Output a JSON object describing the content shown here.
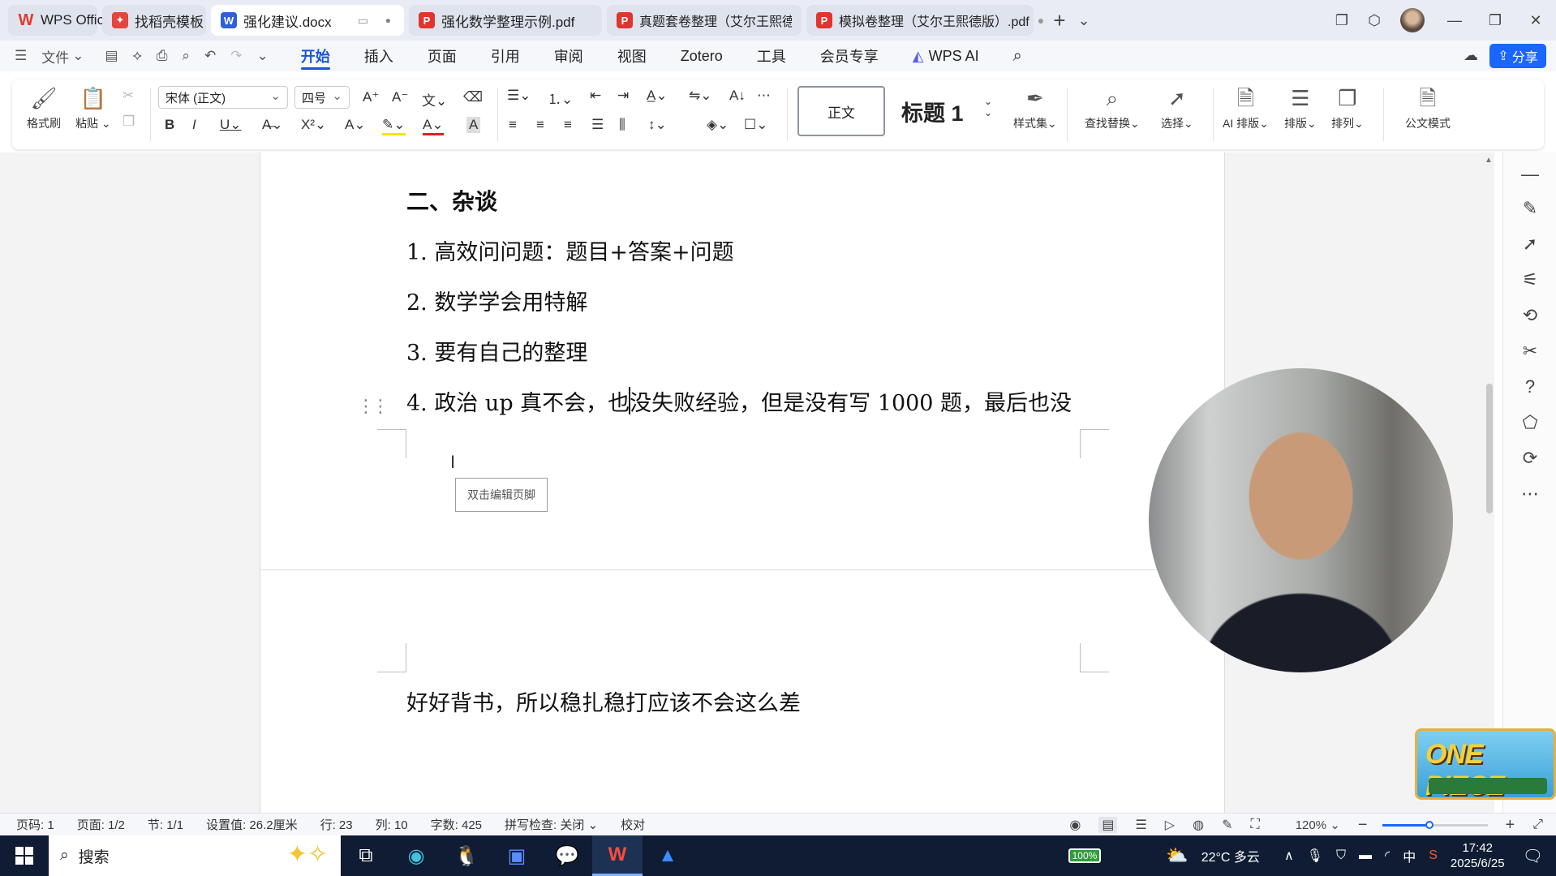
{
  "tabs": [
    {
      "label": "WPS Office",
      "icon": "wps-logo-icon",
      "state": "bg"
    },
    {
      "label": "找稻壳模板",
      "icon": "docer-icon",
      "state": "bg"
    },
    {
      "label": "强化建议.docx",
      "icon": "word-doc-icon",
      "state": "active"
    },
    {
      "label": "强化数学整理示例.pdf",
      "icon": "pdf-icon",
      "state": "bg"
    },
    {
      "label": "真题套卷整理（艾尔王熙德版）.pdf",
      "icon": "pdf-icon",
      "state": "bg"
    },
    {
      "label": "模拟卷整理（艾尔王熙德版）.pdf",
      "icon": "pdf-icon",
      "state": "bg"
    }
  ],
  "menu": {
    "file_label": "文件",
    "items": [
      "开始",
      "插入",
      "页面",
      "引用",
      "审阅",
      "视图",
      "Zotero",
      "工具",
      "会员专享",
      "WPS AI"
    ],
    "active": "开始",
    "share_label": "分享"
  },
  "ribbon": {
    "format_painter": "格式刷",
    "paste": "粘贴",
    "font_name": "宋体 (正文)",
    "font_size": "四号",
    "style_normal": "正文",
    "style_heading": "标题 1",
    "style_set": "样式集",
    "find_replace": "查找替换",
    "select": "选择",
    "ai_layout": "AI 排版",
    "layout": "排版",
    "arrange": "排列",
    "official_mode": "公文模式"
  },
  "document": {
    "heading": "二、杂谈",
    "items": [
      "1. 高效问问题：题目+答案+问题",
      "2. 数学学会用特解",
      "3. 要有自己的整理",
      "4. 政治 up 真不会，也没失败经验，但是没有写 1000 题，最后也没"
    ],
    "footer_tip": "双击编辑页脚",
    "page2_line": "好好背书，所以稳扎稳打应该不会这么差"
  },
  "logo": {
    "title": "ONE PIECE"
  },
  "statusbar": {
    "page_no": "页码: 1",
    "page": "页面: 1/2",
    "section": "节: 1/1",
    "setting": "设置值: 26.2厘米",
    "row": "行: 23",
    "col": "列: 10",
    "word_count": "字数: 425",
    "spell": "拼写检查: 关闭",
    "proof": "校对",
    "zoom": "120%",
    "zoom_level": 0.45
  },
  "taskbar": {
    "search_label": "搜索",
    "battery": "100%",
    "weather": "22°C 多云",
    "ime": "中",
    "time": "17:42",
    "date": "2025/6/25"
  },
  "colors": {
    "accent": "#1a66ff",
    "active_tab_text": "#1a55d8",
    "taskbar": "#0f1c33"
  }
}
